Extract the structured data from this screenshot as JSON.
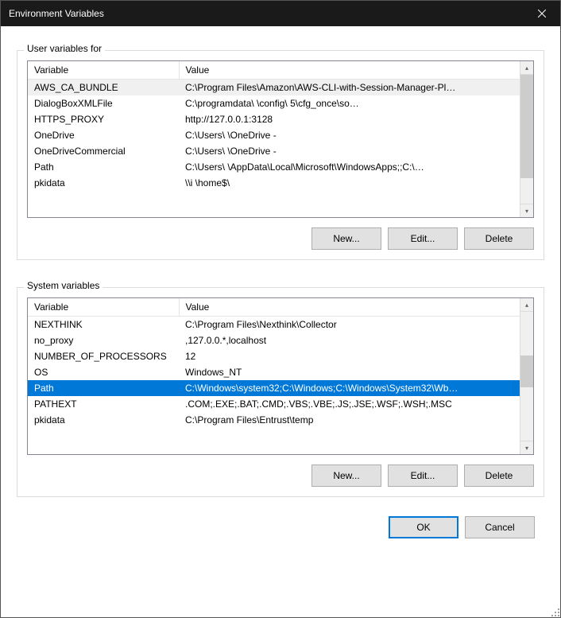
{
  "window": {
    "title": "Environment Variables"
  },
  "user_section": {
    "label": "User variables for",
    "headers": {
      "variable": "Variable",
      "value": "Value"
    },
    "rows": [
      {
        "name": "AWS_CA_BUNDLE",
        "value": "C:\\Program Files\\Amazon\\AWS-CLI-with-Session-Manager-Pl…",
        "highlight": true
      },
      {
        "name": "DialogBoxXMLFile",
        "value": "C:\\programdata\\            \\config\\             5\\cfg_once\\so…"
      },
      {
        "name": "HTTPS_PROXY",
        "value": "http://127.0.0.1:3128"
      },
      {
        "name": "OneDrive",
        "value": "C:\\Users\\         \\OneDrive -"
      },
      {
        "name": "OneDriveCommercial",
        "value": "C:\\Users\\         \\OneDrive -"
      },
      {
        "name": "Path",
        "value": "C:\\Users\\        \\AppData\\Local\\Microsoft\\WindowsApps;;C:\\…"
      },
      {
        "name": "pkidata",
        "value": "\\\\i                                   \\home$\\"
      }
    ],
    "buttons": {
      "new": "New...",
      "edit": "Edit...",
      "delete": "Delete"
    }
  },
  "system_section": {
    "label": "System variables",
    "headers": {
      "variable": "Variable",
      "value": "Value"
    },
    "rows": [
      {
        "name": "NEXTHINK",
        "value": "C:\\Program Files\\Nexthink\\Collector"
      },
      {
        "name": "no_proxy",
        "value": "                                                               ,127.0.0.*,localhost"
      },
      {
        "name": "NUMBER_OF_PROCESSORS",
        "value": "12"
      },
      {
        "name": "OS",
        "value": "Windows_NT"
      },
      {
        "name": "Path",
        "value": "C:\\Windows\\system32;C:\\Windows;C:\\Windows\\System32\\Wb…",
        "selected": true
      },
      {
        "name": "PATHEXT",
        "value": ".COM;.EXE;.BAT;.CMD;.VBS;.VBE;.JS;.JSE;.WSF;.WSH;.MSC"
      },
      {
        "name": "pkidata",
        "value": "C:\\Program Files\\Entrust\\temp"
      }
    ],
    "buttons": {
      "new": "New...",
      "edit": "Edit...",
      "delete": "Delete"
    }
  },
  "footer": {
    "ok": "OK",
    "cancel": "Cancel"
  }
}
